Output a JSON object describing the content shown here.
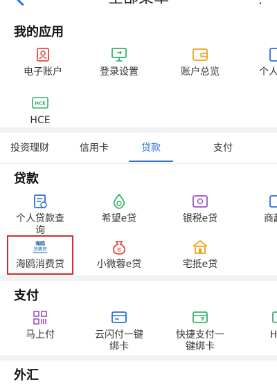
{
  "header": {
    "title": "全部菜单"
  },
  "my_apps": {
    "title": "我的应用",
    "items": [
      {
        "label": "电子账户",
        "icon": "id-card-icon"
      },
      {
        "label": "登录设置",
        "icon": "monitor-settings-icon"
      },
      {
        "label": "账户总览",
        "icon": "wallet-icon"
      },
      {
        "label": "个人信",
        "icon": "person-info-icon"
      },
      {
        "label": "HCE",
        "icon": "hce-card-icon"
      }
    ]
  },
  "tabs": [
    {
      "label": "投资理财"
    },
    {
      "label": "信用卡"
    },
    {
      "label": "贷款",
      "active": true
    },
    {
      "label": "支付"
    }
  ],
  "loans": {
    "title": "贷款",
    "items": [
      {
        "label_line1": "个人贷款查",
        "label_line2": "询",
        "icon": "loan-document-icon"
      },
      {
        "label_line1": "希望e贷",
        "icon": "hope-drop-icon"
      },
      {
        "label_line1": "银税e贷",
        "icon": "tax-card-icon"
      },
      {
        "label_line1": "商起",
        "icon": "business-icon"
      },
      {
        "label_line1": "海鸥消费贷",
        "icon": "haiou-logo-icon",
        "logo_text": "海鸥\n消费贷"
      },
      {
        "label_line1": "小微蓉e贷",
        "icon": "money-bag-icon",
        "badge_text": "蓉"
      },
      {
        "label_line1": "宅抵e贷",
        "icon": "house-icon"
      }
    ]
  },
  "payment": {
    "title": "支付",
    "items": [
      {
        "label_line1": "马上付",
        "icon": "qr-grid-icon"
      },
      {
        "label_line1": "云闪付一键",
        "label_line2": "绑卡",
        "icon": "card-icon"
      },
      {
        "label_line1": "快捷支付一",
        "label_line2": "键绑卡",
        "icon": "quick-card-icon"
      },
      {
        "label_line1": "H",
        "icon": "partial-icon"
      }
    ]
  },
  "forex": {
    "title": "外汇"
  },
  "colors": {
    "accent": "#2a6fd4",
    "highlight": "#d52b2b",
    "red_icon": "#e4473a",
    "green_icon": "#2fb36b",
    "purple_icon": "#9b51c8",
    "orange_icon": "#f0a11a"
  }
}
